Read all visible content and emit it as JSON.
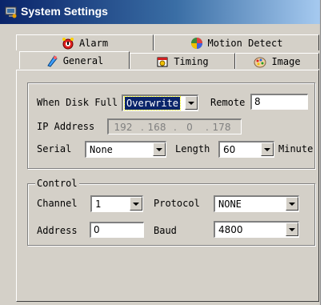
{
  "window": {
    "title": "System Settings",
    "app_icon": "monitor-icon"
  },
  "tabs": [
    {
      "label": "Alarm",
      "icon": "alarm-icon"
    },
    {
      "label": "Motion Detect",
      "icon": "motion-icon"
    },
    {
      "label": "General",
      "icon": "general-icon"
    },
    {
      "label": "Timing",
      "icon": "timing-icon"
    },
    {
      "label": "Image",
      "icon": "image-icon"
    }
  ],
  "general": {
    "disk_full_label": "When Disk Full",
    "disk_full_value": "Overwrite",
    "remote_label": "Remote",
    "remote_value": "8",
    "ip_label": "IP Address",
    "ip": [
      "192",
      "168",
      "0",
      "178"
    ],
    "ip_separator": ".",
    "serial_label": "Serial",
    "serial_value": "None",
    "length_label": "Length",
    "length_value": "60",
    "minute_label": "Minute"
  },
  "control": {
    "title": "Control",
    "channel_label": "Channel",
    "channel_value": "1",
    "protocol_label": "Protocol",
    "protocol_value": "NONE",
    "address_label": "Address",
    "address_value": "0",
    "baud_label": "Baud",
    "baud_value": "4800"
  }
}
